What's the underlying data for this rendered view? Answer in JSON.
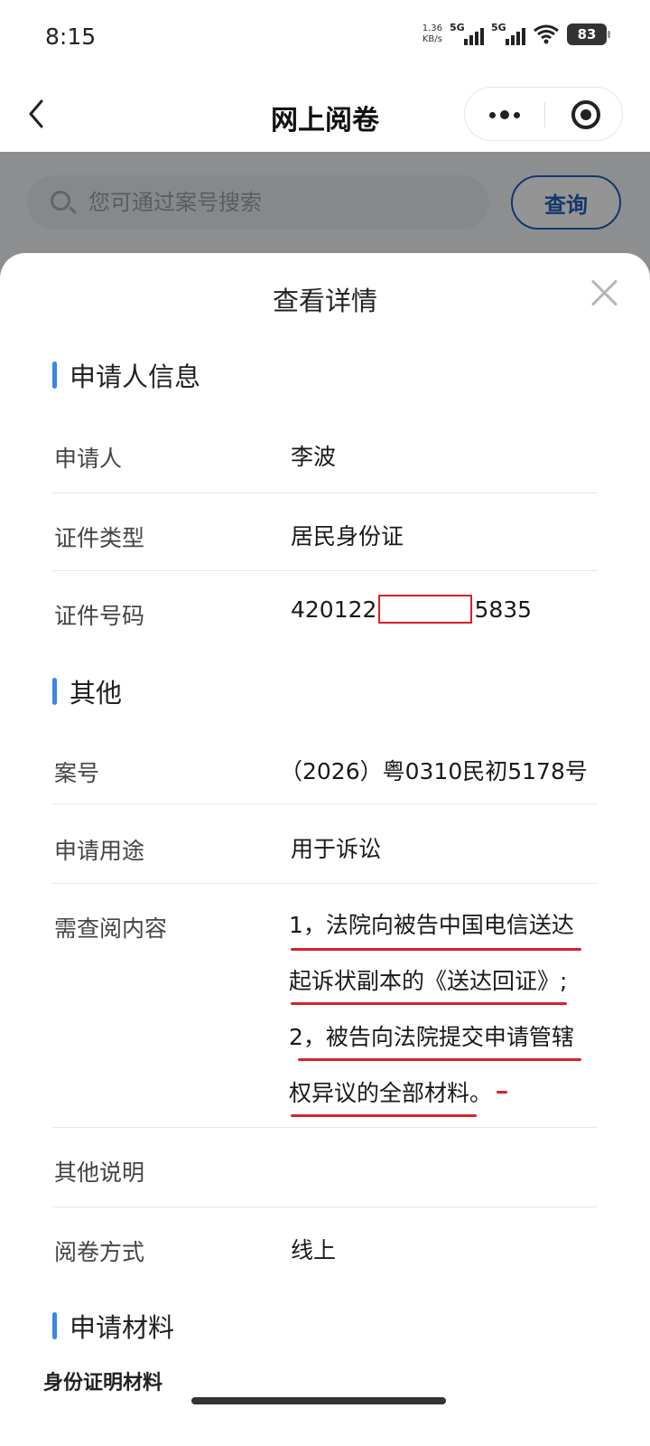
{
  "status_bar": {
    "time": "8:15",
    "net_speed_value": "1.36",
    "net_speed_unit": "KB/s",
    "signal1": "5G",
    "signal2": "5G",
    "wifi_sub": "6",
    "battery": "83"
  },
  "nav": {
    "title": "网上阅卷"
  },
  "search": {
    "placeholder": "您可通过案号搜索",
    "button": "查询"
  },
  "sheet": {
    "title": "查看详情",
    "applicant_section": "申请人信息",
    "applicant_rows": [
      {
        "label": "申请人",
        "value": "李波"
      },
      {
        "label": "证件类型",
        "value": "居民身份证"
      },
      {
        "label": "证件号码",
        "value_prefix": "420122",
        "value_suffix": "5835"
      }
    ],
    "other_section": "其他",
    "other_rows": [
      {
        "label": "案号",
        "value": "（2026）粤0310民初5178号"
      },
      {
        "label": "申请用途",
        "value": "用于诉讼"
      },
      {
        "label": "需查阅内容",
        "lines": [
          "1，法院向被告中国电信送达",
          "起诉状副本的《送达回证》;",
          "2，被告向法院提交申请管辖",
          "权异议的全部材料。"
        ]
      },
      {
        "label": "其他说明",
        "value": ""
      },
      {
        "label": "阅卷方式",
        "value": "线上"
      }
    ],
    "materials_section": "申请材料",
    "materials_sub": "身份证明材料"
  },
  "colors": {
    "accent": "#3b86e6",
    "primary_button": "#1f5fb8",
    "annotation_red": "#d9202a"
  }
}
